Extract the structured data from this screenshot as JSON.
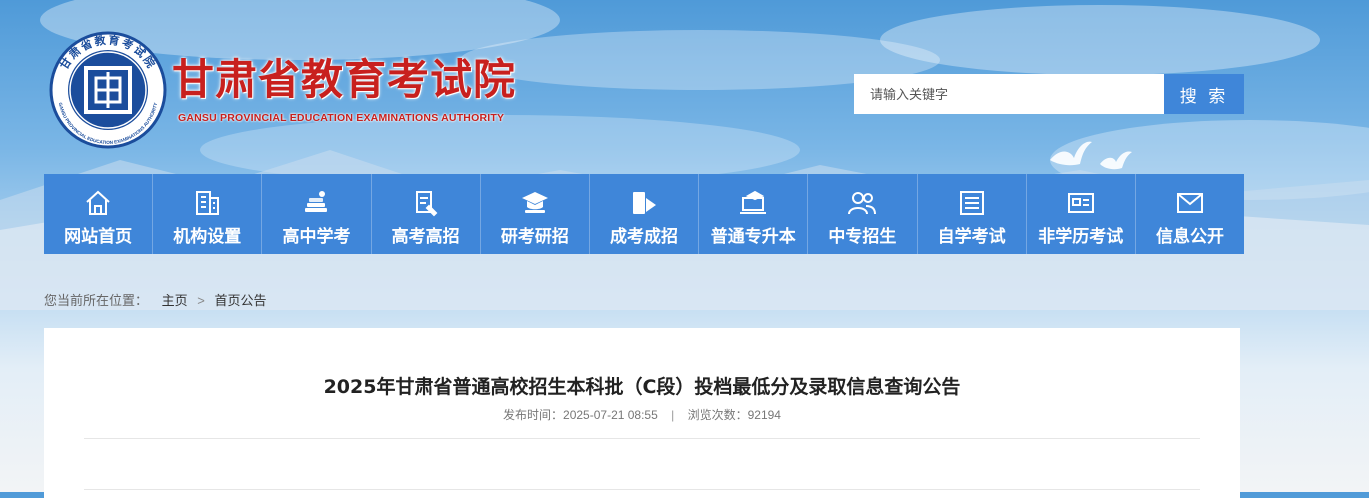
{
  "header": {
    "title": "甘肃省教育考试院",
    "subtitle": "GANSU PROVINCIAL EDUCATION EXAMINATIONS AUTHORITY",
    "logo_ring_text": "甘肃省教育考试院",
    "logo_ring_text_en": "GANSU PROVINCIAL EDUCATION EXAMINATIONS AUTHORITY"
  },
  "search": {
    "placeholder": "请输入关键字",
    "value": "",
    "button_label": "搜 索"
  },
  "nav": {
    "items": [
      {
        "label": "网站首页",
        "icon": "home-icon"
      },
      {
        "label": "机构设置",
        "icon": "building-icon"
      },
      {
        "label": "高中学考",
        "icon": "books-icon"
      },
      {
        "label": "高考高招",
        "icon": "document-pen-icon"
      },
      {
        "label": "研考研招",
        "icon": "graduation-cap-icon"
      },
      {
        "label": "成考成招",
        "icon": "book-arrow-icon"
      },
      {
        "label": "普通专升本",
        "icon": "laptop-graduation-icon"
      },
      {
        "label": "中专招生",
        "icon": "users-icon"
      },
      {
        "label": "自学考试",
        "icon": "notes-icon"
      },
      {
        "label": "非学历考试",
        "icon": "id-card-icon"
      },
      {
        "label": "信息公开",
        "icon": "envelope-icon"
      }
    ]
  },
  "breadcrumb": {
    "prefix": "您当前所在位置：",
    "home": "主页",
    "separator": ">",
    "current": "首页公告"
  },
  "article": {
    "title": "2025年甘肃省普通高校招生本科批（C段）投档最低分及录取信息查询公告",
    "publish_label": "发布时间：",
    "publish_time": "2025-07-21 08:55",
    "meta_divider": "|",
    "views_label": "浏览次数：",
    "views": "92194"
  },
  "colors": {
    "nav_bg": "#3f86d9",
    "title_red": "#c8201e",
    "search_button": "#3f86d9",
    "logo_blue": "#1b4d9c"
  }
}
